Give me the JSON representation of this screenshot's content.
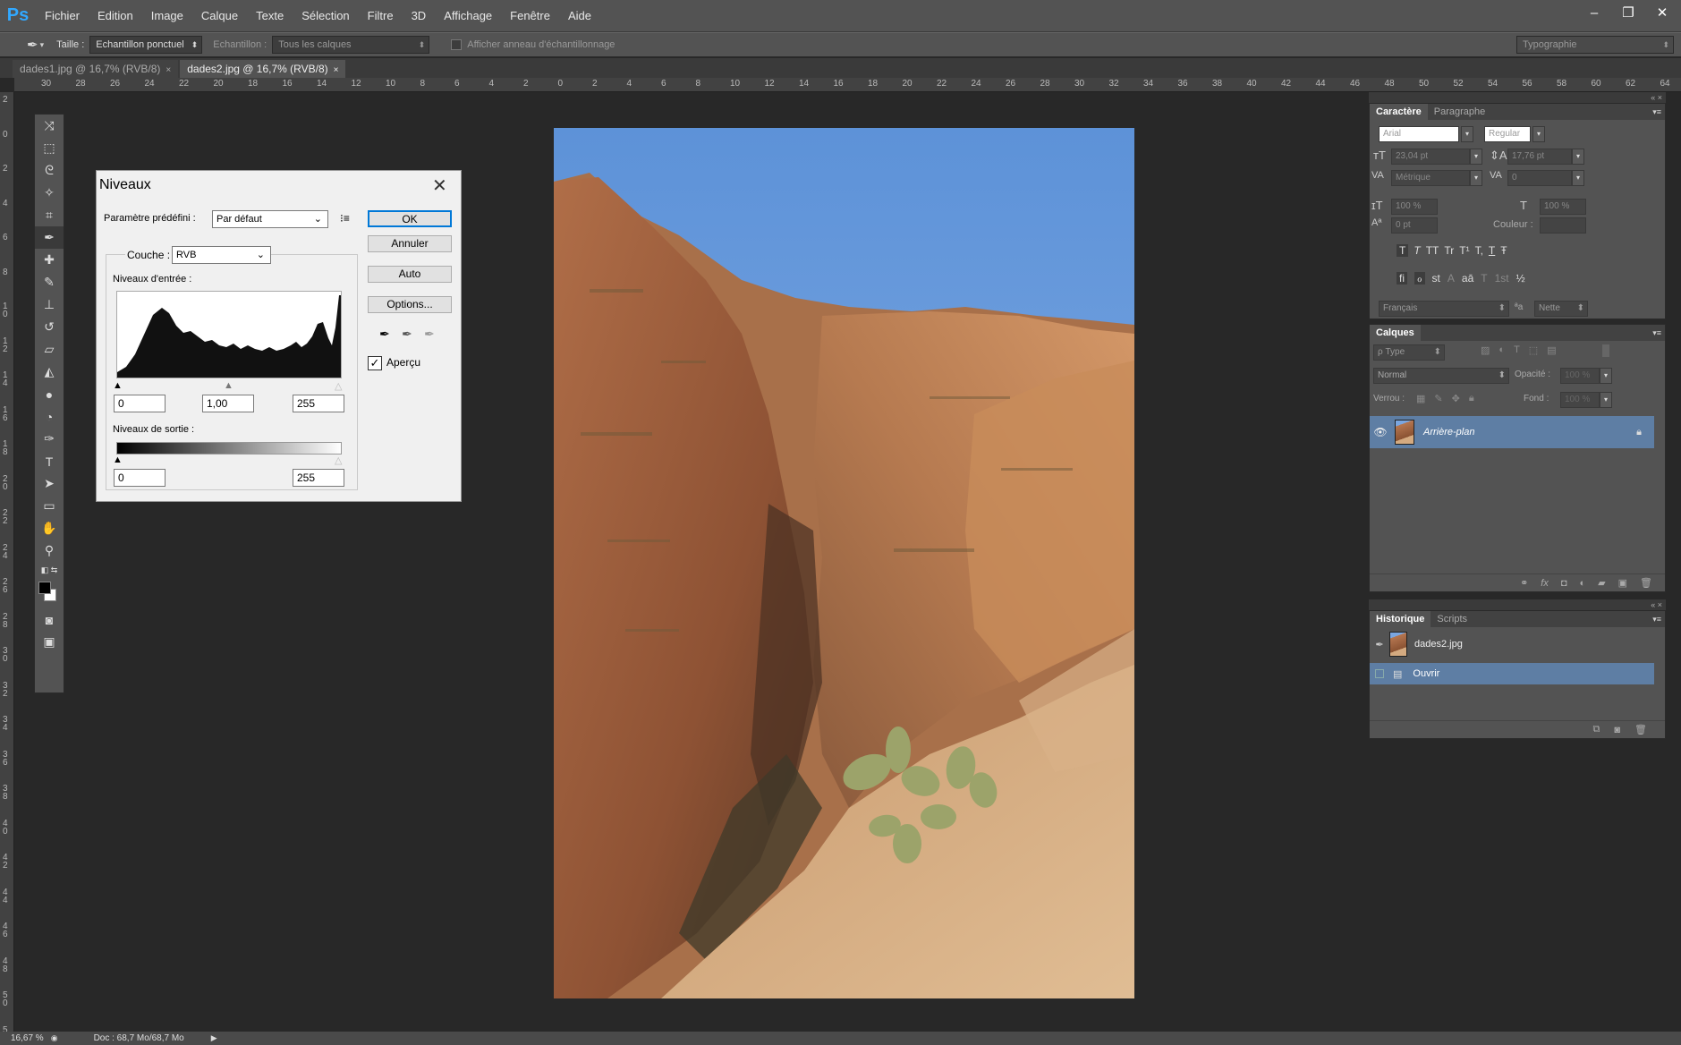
{
  "app": {
    "logo": "Ps"
  },
  "menu": [
    "Fichier",
    "Edition",
    "Image",
    "Calque",
    "Texte",
    "Sélection",
    "Filtre",
    "3D",
    "Affichage",
    "Fenêtre",
    "Aide"
  ],
  "window_controls": [
    "–",
    "❐",
    "✕"
  ],
  "options": {
    "size_label": "Taille :",
    "size_value": "Echantillon ponctuel",
    "sample_label": "Echantillon :",
    "sample_value": "Tous les calques",
    "ring_label": "Afficher anneau d'échantillonnage",
    "workspace": "Typographie"
  },
  "tabs": [
    {
      "label": "dades1.jpg @ 16,7% (RVB/8)",
      "close": "×"
    },
    {
      "label": "dades2.jpg @ 16,7% (RVB/8)",
      "close": "×"
    }
  ],
  "ruler": {
    "h": [
      "30",
      "28",
      "26",
      "24",
      "22",
      "20",
      "18",
      "16",
      "14",
      "12",
      "10",
      "8",
      "6",
      "4",
      "2",
      "0",
      "2",
      "4",
      "6",
      "8",
      "10",
      "12",
      "14",
      "16",
      "18",
      "20",
      "22",
      "24",
      "26",
      "28",
      "30",
      "32",
      "34",
      "36",
      "38",
      "40",
      "42",
      "44",
      "46",
      "48",
      "50",
      "52",
      "54",
      "56",
      "58",
      "60",
      "62",
      "64"
    ],
    "v": [
      "2",
      "0",
      "2",
      "4",
      "6",
      "8",
      "1 0",
      "1 2",
      "1 4",
      "1 6",
      "1 8",
      "2 0",
      "2 2",
      "2 4",
      "2 6",
      "2 8",
      "3 0",
      "3 2",
      "3 4",
      "3 6",
      "3 8",
      "4 0",
      "4 2",
      "4 4",
      "4 6",
      "4 8",
      "5 0",
      "5 2"
    ]
  },
  "tools": [
    "move-tool",
    "marquee-tool",
    "lasso-tool",
    "magic-wand-tool",
    "crop-tool",
    "eyedropper-tool",
    "healing-tool",
    "brush-tool",
    "stamp-tool",
    "history-brush-tool",
    "eraser-tool",
    "bucket-tool",
    "blur-tool",
    "dodge-tool",
    "pen-tool",
    "type-tool",
    "path-select-tool",
    "shape-tool",
    "hand-tool",
    "zoom-tool"
  ],
  "dialog": {
    "title": "Niveaux",
    "preset_label": "Paramètre prédéfini :",
    "preset_value": "Par défaut",
    "channel_label": "Couche :",
    "channel_value": "RVB",
    "input_levels_label": "Niveaux d'entrée :",
    "input_black": "0",
    "input_gamma": "1,00",
    "input_white": "255",
    "output_levels_label": "Niveaux de sortie :",
    "output_black": "0",
    "output_white": "255",
    "btn_ok": "OK",
    "btn_cancel": "Annuler",
    "btn_auto": "Auto",
    "btn_options": "Options...",
    "preview_label": "Aperçu",
    "preview_checked": true
  },
  "character_panel": {
    "tabs": [
      "Caractère",
      "Paragraphe"
    ],
    "font": "Arial",
    "style": "Regular",
    "size": "23,04 pt",
    "leading": "17,76 pt",
    "kerning": "Métrique",
    "tracking": "0",
    "vscale": "100 %",
    "hscale": "100 %",
    "baseline": "0 pt",
    "color_label": "Couleur :",
    "styles_row1": [
      "T",
      "T",
      "TT",
      "Tr",
      "T¹",
      "T,",
      "T",
      "Ŧ"
    ],
    "styles_row2": [
      "fi",
      "ℴ",
      "st",
      "A",
      "aā",
      "T",
      "1st",
      "½"
    ],
    "language": "Français",
    "aa_label": "ªa",
    "antialias": "Nette"
  },
  "layers_panel": {
    "tab": "Calques",
    "filter": "ρ Type",
    "blend": "Normal",
    "opacity_label": "Opacité :",
    "opacity_value": "100 %",
    "lock_label": "Verrou :",
    "fill_label": "Fond :",
    "fill_value": "100 %",
    "layer_name": "Arrière-plan"
  },
  "history_panel": {
    "tabs": [
      "Historique",
      "Scripts"
    ],
    "snapshot": "dades2.jpg",
    "step": "Ouvrir"
  },
  "status": {
    "zoom": "16,67 %",
    "doc": "Doc : 68,7 Mo/68,7 Mo"
  }
}
